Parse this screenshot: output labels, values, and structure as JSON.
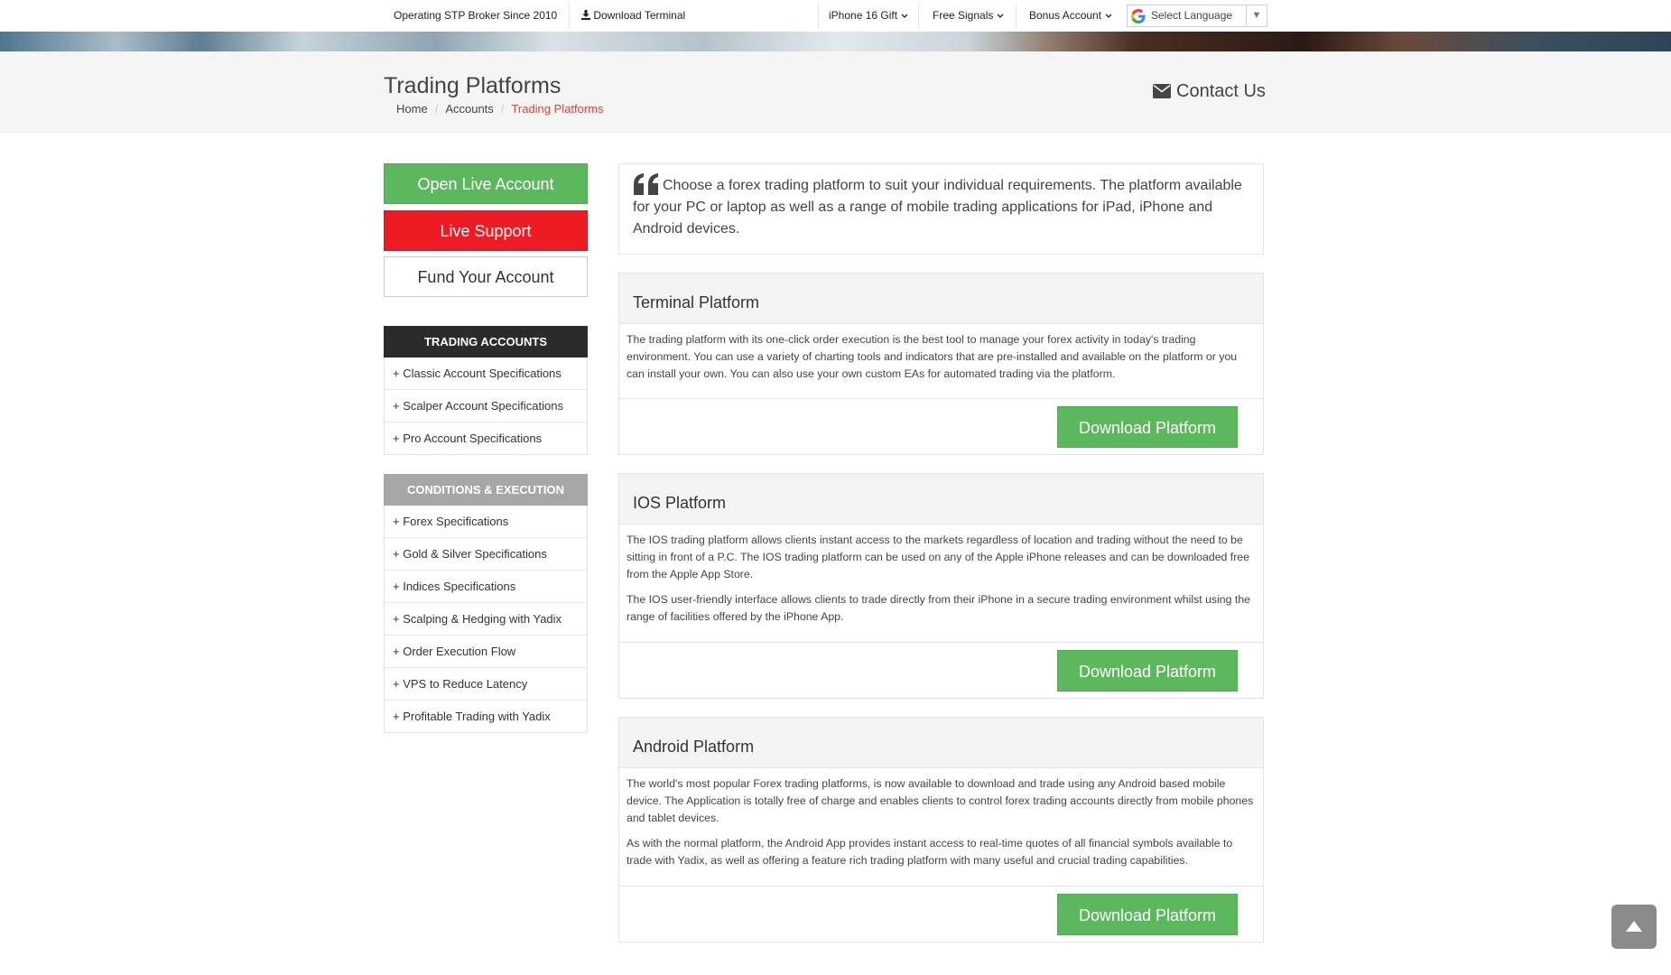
{
  "topbar": {
    "tagline": "Operating STP Broker Since 2010",
    "download_terminal": "Download Terminal",
    "iphone_gift": "iPhone 16 Gift",
    "free_signals": "Free Signals",
    "bonus_account": "Bonus Account",
    "language": "Select Language"
  },
  "page": {
    "title": "Trading Platforms",
    "breadcrumb": [
      "Home",
      "Accounts",
      "Trading Platforms"
    ],
    "contact": "Contact Us"
  },
  "sidebar": {
    "open_live": "Open Live Account",
    "live_support": "Live Support",
    "fund": "Fund Your Account",
    "accounts_heading": "TRADING ACCOUNTS",
    "accounts": [
      "+ Classic Account Specifications",
      "+ Scalper Account Specifications",
      "+ Pro Account Specifications"
    ],
    "conditions_heading": "CONDITIONS & EXECUTION",
    "conditions": [
      "+ Forex Specifications",
      "+ Gold & Silver Specifications",
      "+ Indices Specifications",
      "+ Scalping & Hedging with Yadix",
      "+ Order Execution Flow",
      "+ VPS to Reduce Latency",
      "+ Profitable Trading with Yadix"
    ]
  },
  "intro": "Choose a forex trading platform to suit your individual requirements. The platform available for your PC or laptop as well as a range of mobile trading applications for iPad, iPhone and Android devices.",
  "platforms": [
    {
      "title": "Terminal Platform",
      "paragraphs": [
        "The trading platform with its one-click order execution is the best tool to manage your forex activity in today's trading environment. You can use a variety of charting tools and indicators that are pre-installed and available on the platform or you can install your own. You can also use your own custom EAs for automated trading via the platform."
      ],
      "button": "Download Platform"
    },
    {
      "title": "IOS Platform",
      "paragraphs": [
        "The IOS trading platform allows clients instant access to the markets regardless of location and trading without the need to be sitting in front of a P.C. The IOS trading platform can be used on any of the Apple iPhone releases and can be downloaded free from the Apple App Store.",
        "The IOS user-friendly interface allows clients to trade directly from their iPhone in a secure trading environment whilst using the range of facilities offered by the iPhone App."
      ],
      "button": "Download Platform"
    },
    {
      "title": "Android Platform",
      "paragraphs": [
        "The world's most popular Forex trading platforms, is now available to download and trade using any Android based mobile device. The Application is totally free of charge and enables clients to control forex trading accounts directly from mobile phones and tablet devices.",
        "As with the normal platform, the Android App provides instant access to real-time quotes of all financial symbols available to trade with Yadix, as well as offering a feature rich trading platform with many useful and crucial trading capabilities."
      ],
      "button": "Download Platform"
    }
  ],
  "colors": {
    "green": "#5cb85c",
    "red": "#ed1c24",
    "dark_heading": "#2b2b2b",
    "grey_heading": "#a6a6a6",
    "breadcrumb_active": "#e0433b"
  },
  "icons": {
    "download": "download-icon",
    "caret": "chevron-down-icon",
    "google": "google-icon",
    "envelope": "envelope-icon",
    "quote": "quote-icon",
    "scroll_top": "arrow-up-icon"
  }
}
